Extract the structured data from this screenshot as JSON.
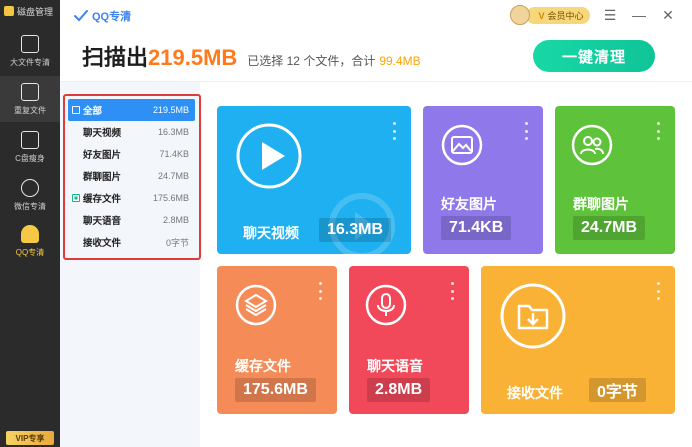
{
  "sidebar": {
    "header": "磁盘管理",
    "items": [
      {
        "label": "大文件专清"
      },
      {
        "label": "重复文件"
      },
      {
        "label": "C盘瘦身"
      },
      {
        "label": "微信专清"
      },
      {
        "label": "QQ专清"
      }
    ],
    "vip_badge": "VIP专享"
  },
  "header": {
    "app_name": "QQ专清",
    "vip_center": "会员中心",
    "vip_letter": "V",
    "headline_prefix": "扫描出",
    "headline_size": "219.5MB",
    "selected_text": "已选择 12 个文件，合计",
    "selected_size": "99.4MB",
    "clean_button": "一键清理"
  },
  "filters": [
    {
      "label": "全部",
      "size": "219.5MB"
    },
    {
      "label": "聊天视频",
      "size": "16.3MB"
    },
    {
      "label": "好友图片",
      "size": "71.4KB"
    },
    {
      "label": "群聊图片",
      "size": "24.7MB"
    },
    {
      "label": "缓存文件",
      "size": "175.6MB"
    },
    {
      "label": "聊天语音",
      "size": "2.8MB"
    },
    {
      "label": "接收文件",
      "size": "0字节"
    }
  ],
  "tiles": [
    {
      "title": "聊天视频",
      "size": "16.3MB",
      "icon": "play-icon",
      "color": "#1eb0f0"
    },
    {
      "title": "好友图片",
      "size": "71.4KB",
      "icon": "image-icon",
      "color": "#8f79ea"
    },
    {
      "title": "群聊图片",
      "size": "24.7MB",
      "icon": "group-icon",
      "color": "#5fc23b"
    },
    {
      "title": "缓存文件",
      "size": "175.6MB",
      "icon": "layers-icon",
      "color": "#f58b57"
    },
    {
      "title": "聊天语音",
      "size": "2.8MB",
      "icon": "microphone-icon",
      "color": "#f1495a"
    },
    {
      "title": "接收文件",
      "size": "0字节",
      "icon": "download-folder-icon",
      "color": "#f9b236"
    }
  ]
}
